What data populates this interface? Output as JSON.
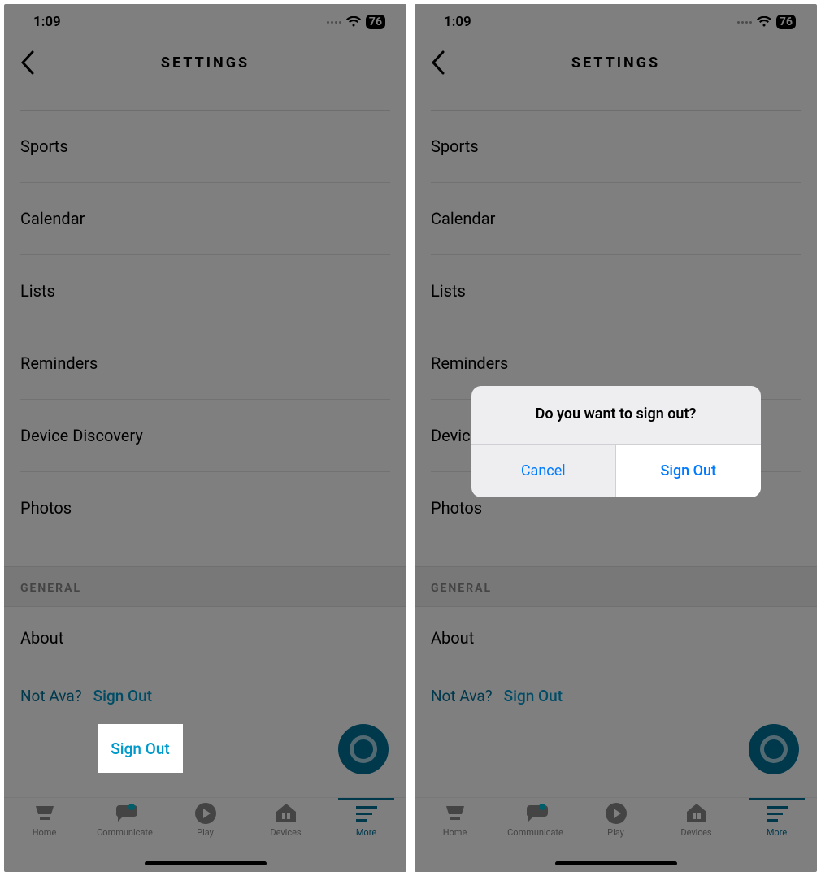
{
  "status": {
    "time": "1:09",
    "battery": "76"
  },
  "header": {
    "title": "SETTINGS"
  },
  "items": {
    "sports": "Sports",
    "calendar": "Calendar",
    "lists": "Lists",
    "reminders": "Reminders",
    "device_discovery": "Device Discovery",
    "photos": "Photos"
  },
  "section": {
    "general": "GENERAL"
  },
  "general_items": {
    "about": "About"
  },
  "footer": {
    "not_user": "Not Ava?",
    "sign_out": "Sign Out"
  },
  "tabs": {
    "home": "Home",
    "communicate": "Communicate",
    "play": "Play",
    "devices": "Devices",
    "more": "More"
  },
  "dialog": {
    "title": "Do you want to sign out?",
    "cancel": "Cancel",
    "confirm": "Sign Out"
  }
}
